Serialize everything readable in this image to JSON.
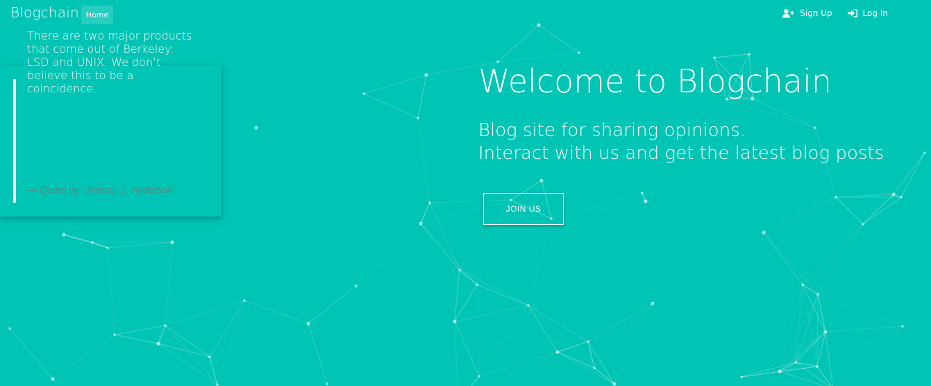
{
  "navbar": {
    "brand": "Blogchain",
    "home_label": "Home",
    "signup_label": "Sign Up",
    "login_label": "Log In",
    "signup_icon": "user-plus-icon",
    "login_icon": "sign-in-icon"
  },
  "quote": {
    "text": "There are two major products that come out of Berkeley: LSD and UNIX. We don’t believe this to be a coincidence.",
    "by_prefix": "— Quote by ",
    "author": "\"Jeremy S. Anderson\""
  },
  "hero": {
    "title": "Welcome to Blogchain",
    "subtitle_line1": "Blog site for sharing opinions.",
    "subtitle_line2": "Interact with us and get the latest blog posts",
    "cta_label": "JOIN US"
  },
  "colors": {
    "background": "#00c4b4",
    "foreground": "#ffffff",
    "quote_attribution": "#4c8f88"
  }
}
